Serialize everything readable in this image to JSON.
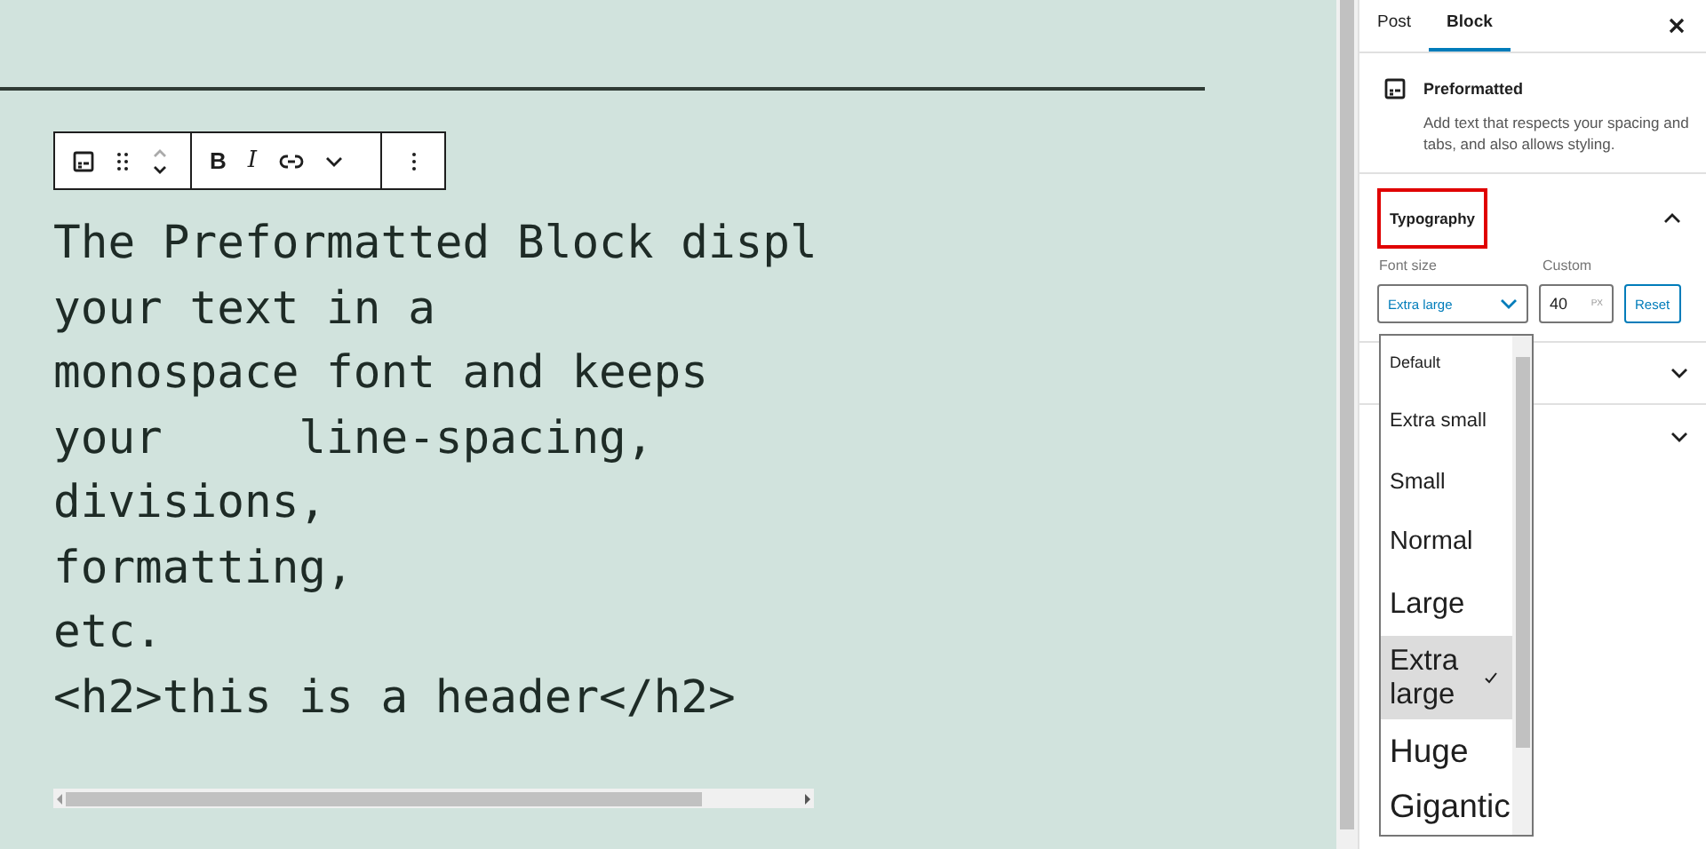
{
  "toolbar": {
    "buttons": [
      {
        "kind": "block-type"
      },
      {
        "kind": "drag"
      },
      {
        "kind": "move"
      },
      {
        "kind": "bold",
        "label": "B"
      },
      {
        "kind": "italic",
        "label": "I"
      },
      {
        "kind": "link"
      },
      {
        "kind": "more-rich"
      },
      {
        "kind": "options"
      }
    ]
  },
  "code_lines": [
    "The Preformatted Block displ",
    "your text in a",
    "monospace font and keeps",
    "your     line-spacing,",
    "divisions,",
    "formatting,",
    "etc.",
    "<h2>this is a header</h2>"
  ],
  "sidebar": {
    "tabs": [
      {
        "label": "Post",
        "selected": false
      },
      {
        "label": "Block",
        "selected": true
      }
    ],
    "block": {
      "title": "Preformatted",
      "description": "Add text that respects your spacing and tabs, and also allows styling."
    },
    "typography": {
      "title": "Typography",
      "expanded": true,
      "font_size_label": "Font size",
      "custom_label": "Custom",
      "font_size_value": "Extra large",
      "custom_value": "40",
      "unit": "PX",
      "reset": "Reset"
    },
    "font_size_options": [
      {
        "label": "Default",
        "selected": false
      },
      {
        "label": "Extra small",
        "selected": false
      },
      {
        "label": "Small",
        "selected": false
      },
      {
        "label": "Normal",
        "selected": false
      },
      {
        "label": "Large",
        "selected": false
      },
      {
        "label": "Extra large",
        "selected": true
      },
      {
        "label": "Huge",
        "selected": false
      },
      {
        "label": "Gigantic",
        "selected": false
      }
    ]
  }
}
